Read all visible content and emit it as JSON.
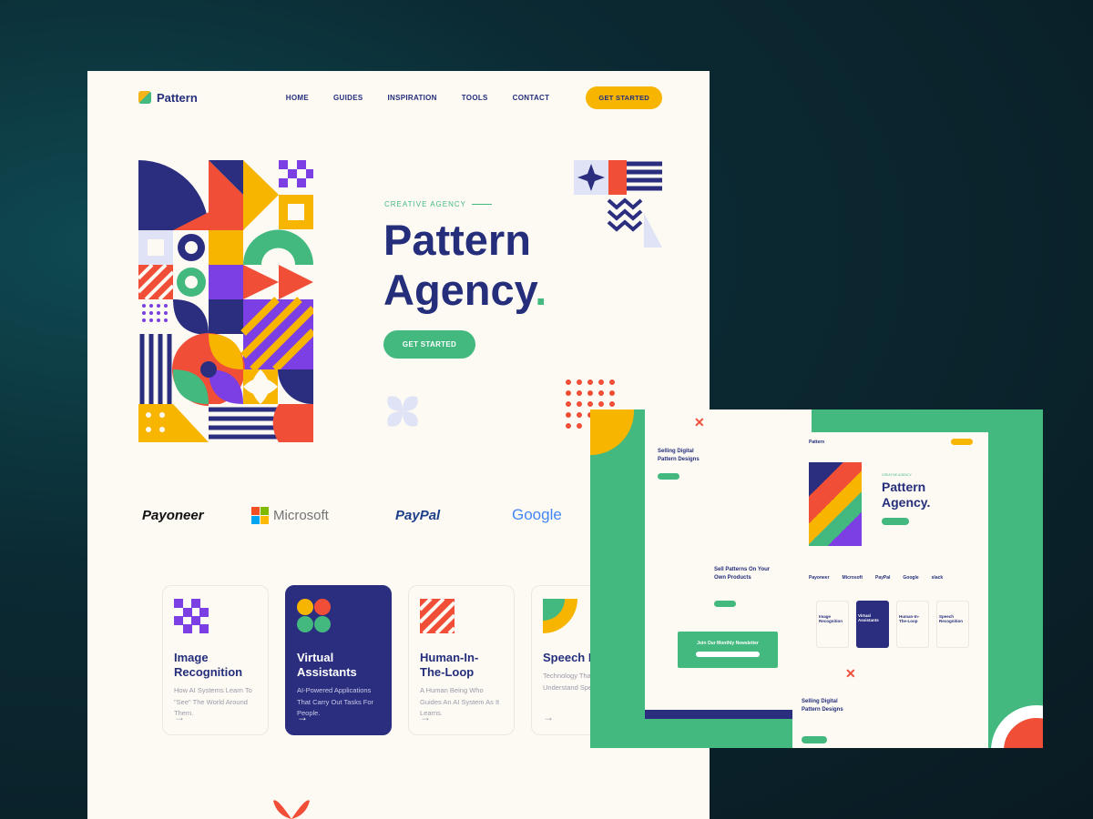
{
  "nav": {
    "logo": "Pattern",
    "links": [
      "HOME",
      "GUIDES",
      "INSPIRATION",
      "TOOLS",
      "CONTACT"
    ],
    "cta": "GET STARTED"
  },
  "hero": {
    "eyebrow": "CREATIVE AGENCY",
    "title_line1": "Pattern",
    "title_line2": "Agency",
    "title_dot": ".",
    "cta": "GET STARTED"
  },
  "brands": [
    "Payoneer",
    "Microsoft",
    "PayPal",
    "Google"
  ],
  "cards": [
    {
      "title": "Image Recognition",
      "desc": "How AI Systems Learn To \"See\" The World Around Them.",
      "icon": "checker-icon"
    },
    {
      "title": "Virtual Assistants",
      "desc": "AI-Powered Applications That Carry Out Tasks For People.",
      "icon": "blob-icon"
    },
    {
      "title": "Human-In-The-Loop",
      "desc": "A Human Being Who Guides An AI System As It Learns.",
      "icon": "stripes-icon"
    },
    {
      "title": "Speech Recognition",
      "desc": "Technology That Helps To Understand Speech.",
      "icon": "quarter-icon"
    }
  ],
  "preview": {
    "left_title": "Selling Digital Pattern Designs",
    "mid_title": "Sell Patterns On Your Own Products",
    "newsletter": "Join Our Monthly Newsletter",
    "right_logo": "Pattern",
    "right_eyebrow": "CREATIVE AGENCY",
    "right_title": "Pattern Agency.",
    "right_brands": [
      "Payoneer",
      "Microsoft",
      "PayPal",
      "Google",
      "slack"
    ],
    "right_cards": [
      "Image Recognition",
      "Virtual Assistants",
      "Human-In-The-Loop",
      "Speech Recognition"
    ],
    "right_bottom_title": "Selling Digital Pattern Designs"
  },
  "colors": {
    "navy": "#242e7a",
    "green": "#43b97f",
    "yellow": "#f7b500",
    "red": "#f04e37",
    "purple": "#7b3fe4"
  }
}
